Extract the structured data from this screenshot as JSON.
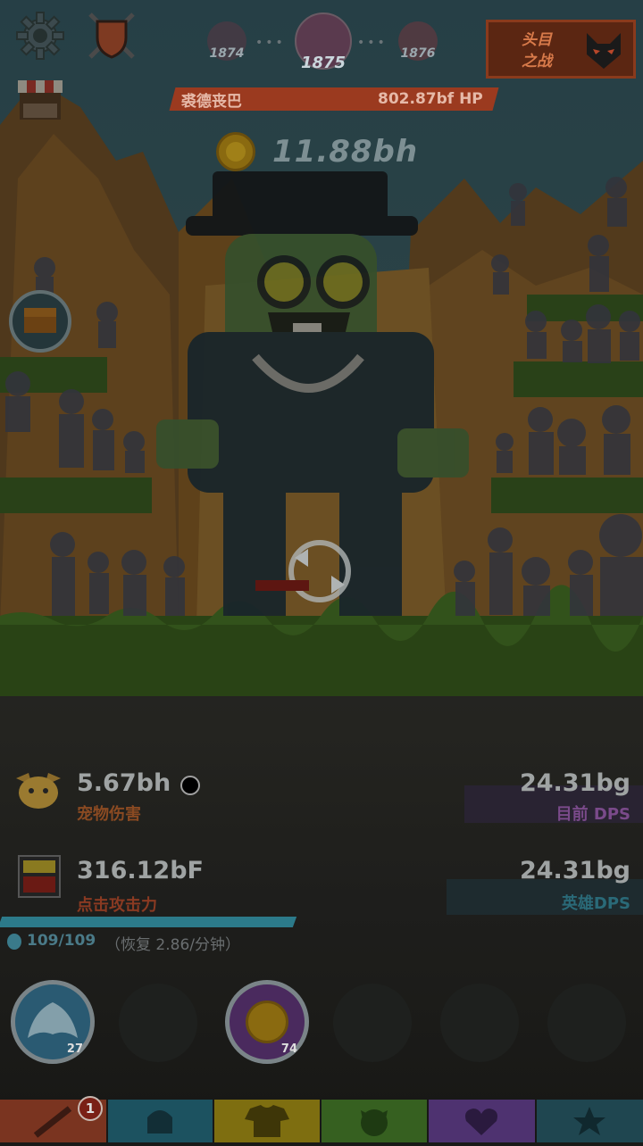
{
  "stages": {
    "prev": "1874",
    "current": "1875",
    "next": "1876"
  },
  "boss": {
    "name": "裘德丧巴",
    "hp": "802.87bf HP"
  },
  "gold": {
    "amount": "11.88bh"
  },
  "boss_fight": {
    "label": "头目之战"
  },
  "stats": {
    "pet_damage_value": "5.67bh",
    "pet_damage_label": "宠物伤害",
    "current_dps_value": "24.31bg",
    "current_dps_label": "目前 DPS",
    "tap_damage_value": "316.12bF",
    "tap_damage_label": "点击攻击力",
    "hero_dps_value": "24.31bg",
    "hero_dps_label": "英雄DPS"
  },
  "mana": {
    "value": "109/109",
    "regen": "（恢复 2.86/分钟）",
    "fraction": 1.0
  },
  "skills": [
    {
      "name": "heavenly-strike",
      "level": "27"
    },
    {
      "name": "locked-skill-2",
      "level": ""
    },
    {
      "name": "hand-of-midas",
      "level": "74"
    },
    {
      "name": "locked-skill-4",
      "level": ""
    },
    {
      "name": "locked-skill-5",
      "level": ""
    },
    {
      "name": "locked-skill-6",
      "level": ""
    }
  ],
  "tabs": [
    {
      "name": "hero",
      "color": "#8a3a22",
      "icon": "sword-icon",
      "badge": "1"
    },
    {
      "name": "heroes",
      "color": "#1f5a66",
      "icon": "helmet-icon",
      "badge": ""
    },
    {
      "name": "equipment",
      "color": "#8a7a12",
      "icon": "shirt-icon",
      "badge": ""
    },
    {
      "name": "pets",
      "color": "#3e6a1e",
      "icon": "pet-icon",
      "badge": ""
    },
    {
      "name": "clan",
      "color": "#5a3a7a",
      "icon": "heart-icon",
      "badge": ""
    },
    {
      "name": "shop",
      "color": "#24505a",
      "icon": "star-icon",
      "badge": ""
    }
  ]
}
